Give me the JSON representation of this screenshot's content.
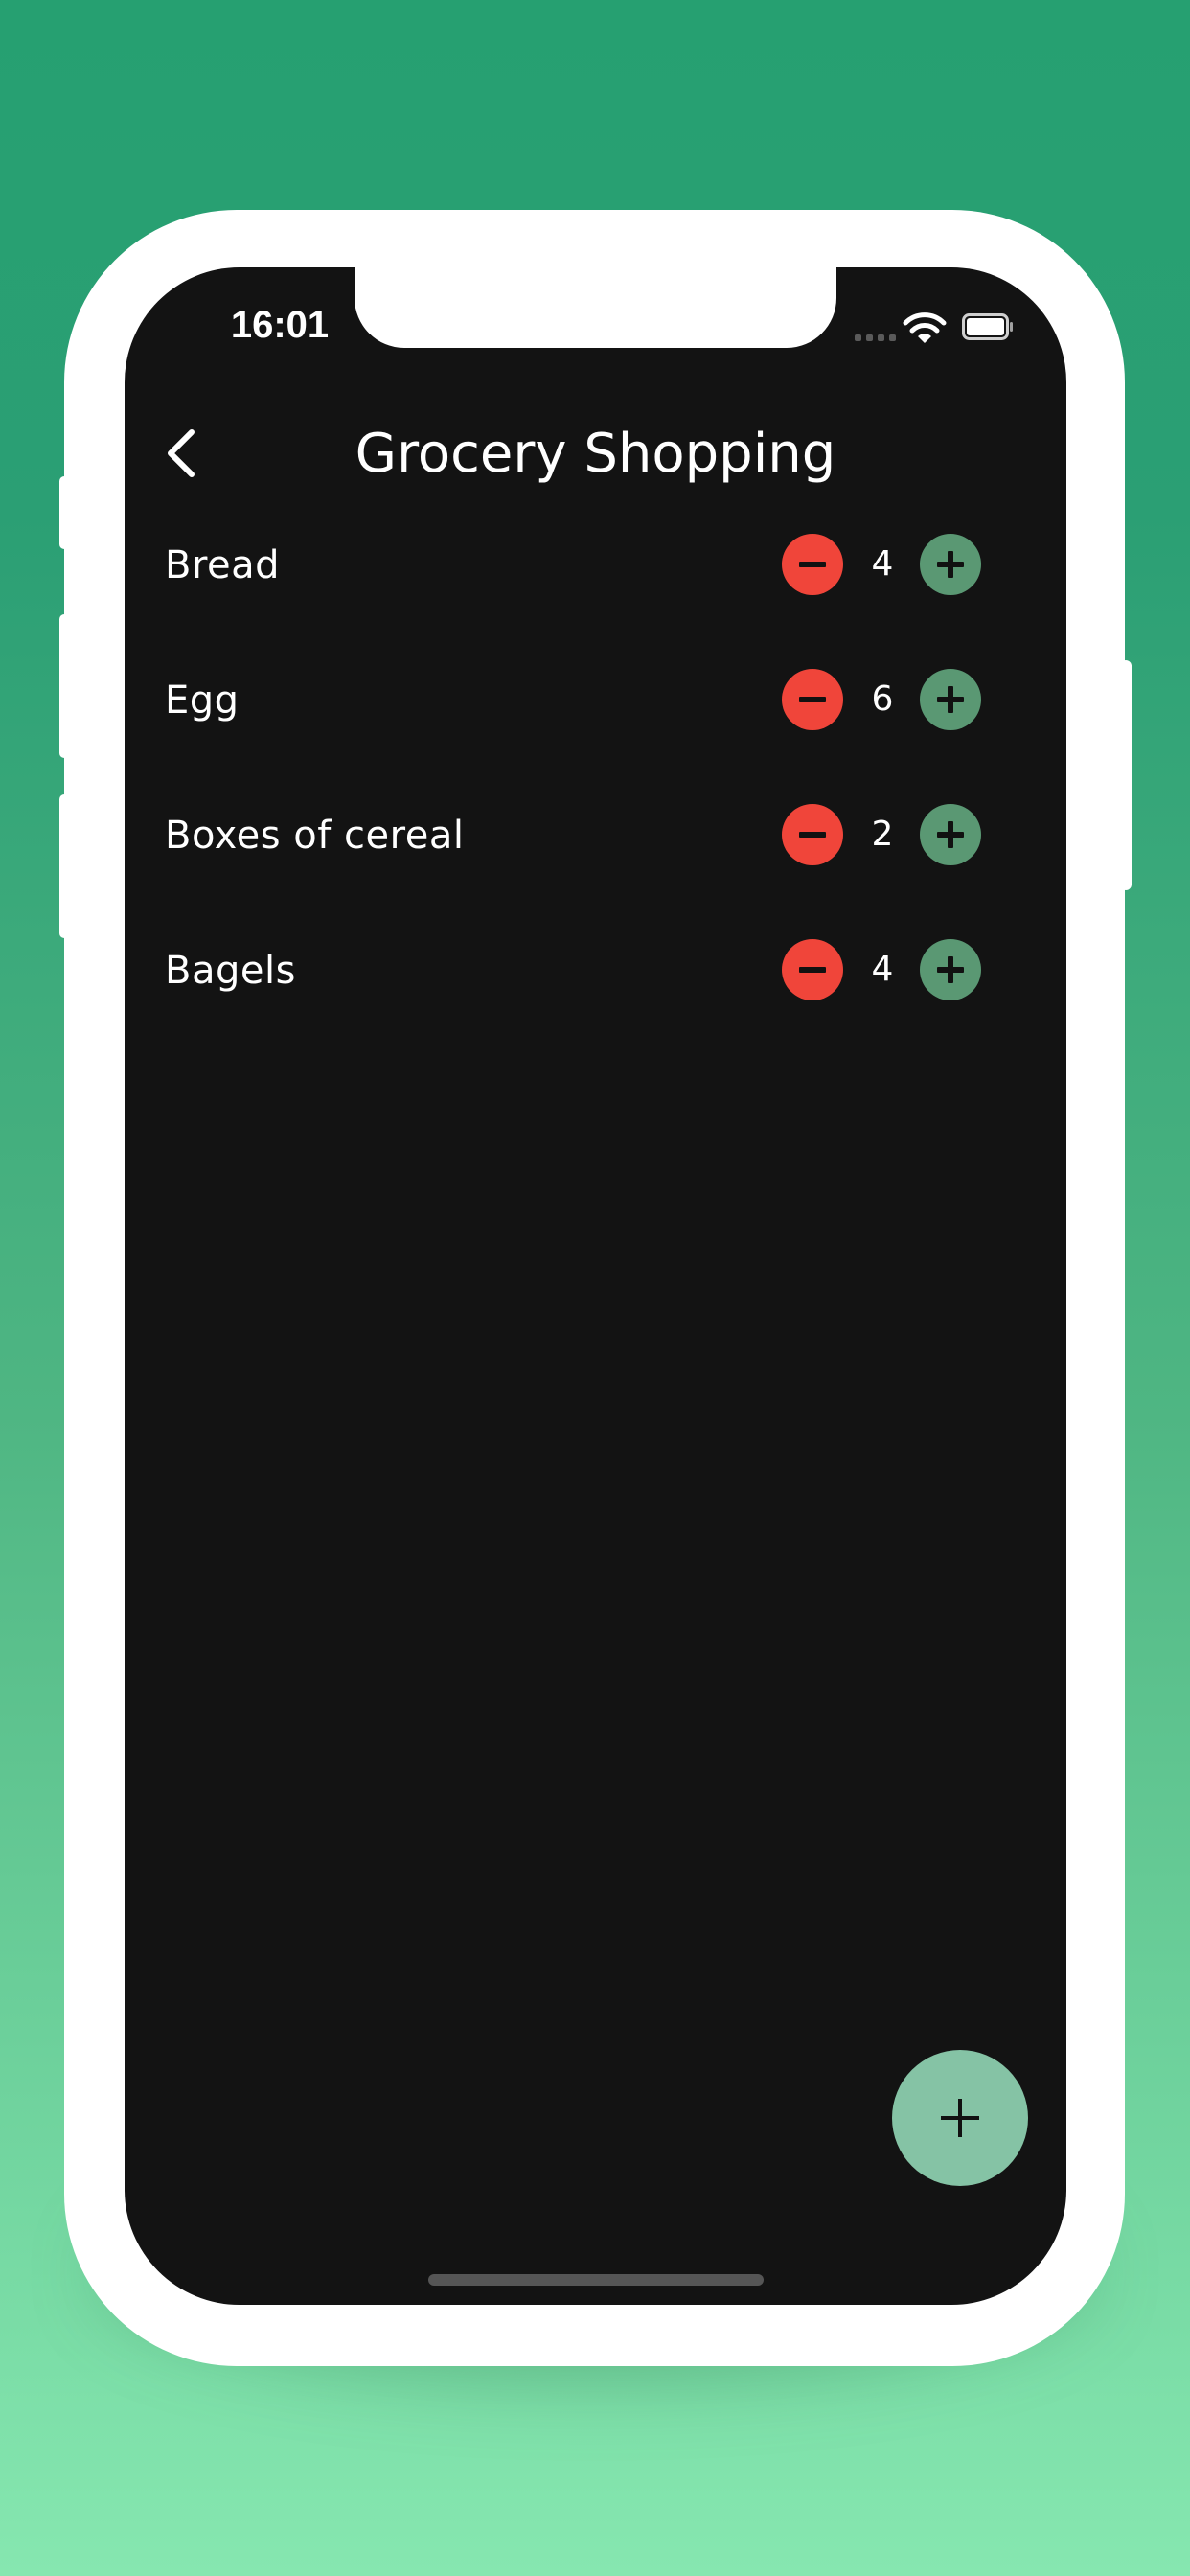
{
  "status_bar": {
    "time": "16:01"
  },
  "header": {
    "title": "Grocery Shopping",
    "back_icon": "chevron-left-icon"
  },
  "items": [
    {
      "name": "Bread",
      "quantity": "4"
    },
    {
      "name": "Egg",
      "quantity": "6"
    },
    {
      "name": "Boxes of cereal",
      "quantity": "2"
    },
    {
      "name": "Bagels",
      "quantity": "4"
    }
  ],
  "colors": {
    "screen_background": "#131313",
    "minus_button": "#f0453a",
    "plus_button": "#5a9873",
    "fab": "#85c3a5",
    "page_gradient_top": "#26a071",
    "page_gradient_bottom": "#86e7b0"
  },
  "icons": {
    "decrement": "minus-icon",
    "increment": "plus-icon",
    "fab": "plus-icon"
  }
}
